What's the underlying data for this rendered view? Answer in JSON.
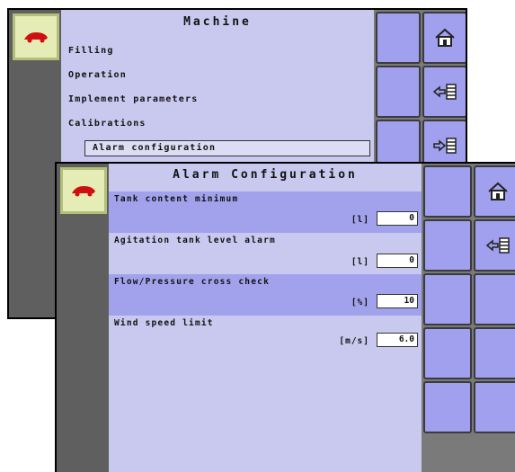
{
  "back_screen": {
    "title": "Machine",
    "menu": [
      "Filling",
      "Operation",
      "Implement parameters",
      "Calibrations",
      "Alarm configuration"
    ],
    "icons": [
      "home-icon",
      "back-list-icon",
      "forward-list-icon"
    ]
  },
  "front_screen": {
    "title": "Alarm Configuration",
    "rows": [
      {
        "label": "Tank content minimum",
        "unit": "[l]",
        "value": "0",
        "highlighted": true
      },
      {
        "label": "Agitation tank level alarm",
        "unit": "[l]",
        "value": "0",
        "highlighted": false
      },
      {
        "label": "Flow/Pressure cross check",
        "unit": "[%]",
        "value": "10",
        "highlighted": true
      },
      {
        "label": "Wind speed limit",
        "unit": "[m/s]",
        "value": "6.0",
        "highlighted": false
      }
    ],
    "icons": [
      "home-icon",
      "back-list-icon"
    ]
  },
  "colors": {
    "content_bg": "#c9c9ef",
    "highlight_row": "#a2a2ec",
    "side_button": "#a0a0ee",
    "logo_bg": "#e6ecb6",
    "left_bar": "#5f5f5f"
  }
}
